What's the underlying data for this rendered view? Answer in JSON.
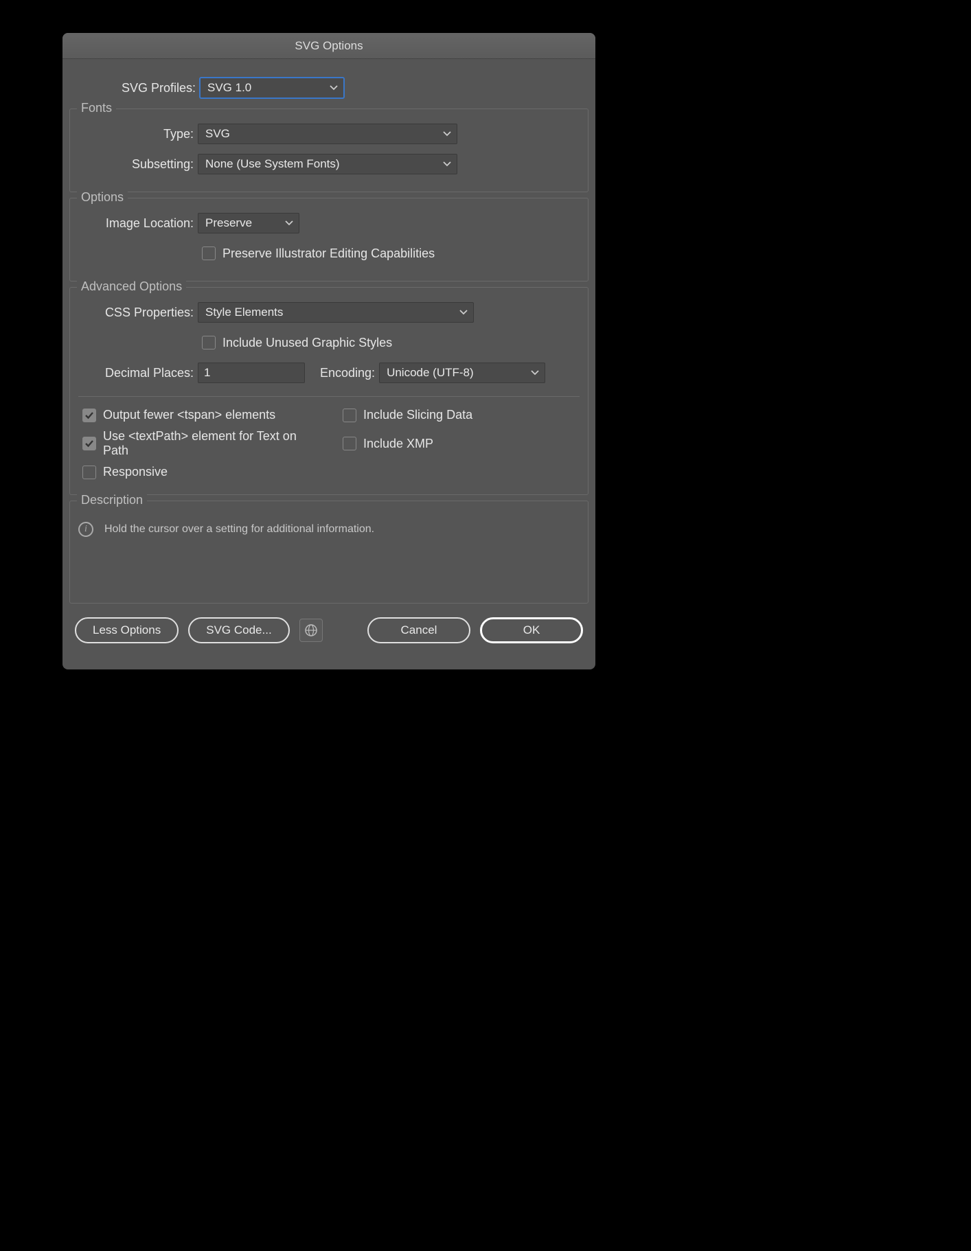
{
  "title": "SVG Options",
  "profiles": {
    "label": "SVG Profiles:",
    "value": "SVG 1.0"
  },
  "fonts": {
    "title": "Fonts",
    "type_label": "Type:",
    "type_value": "SVG",
    "subsetting_label": "Subsetting:",
    "subsetting_value": "None (Use System Fonts)"
  },
  "options": {
    "title": "Options",
    "image_location_label": "Image Location:",
    "image_location_value": "Preserve",
    "preserve_editing_label": "Preserve Illustrator Editing Capabilities",
    "preserve_editing_checked": false
  },
  "advanced": {
    "title": "Advanced Options",
    "css_label": "CSS Properties:",
    "css_value": "Style Elements",
    "include_unused_label": "Include Unused Graphic Styles",
    "include_unused_checked": false,
    "decimal_label": "Decimal Places:",
    "decimal_value": "1",
    "encoding_label": "Encoding:",
    "encoding_value": "Unicode (UTF-8)",
    "output_tspan_label": "Output fewer <tspan> elements",
    "output_tspan_checked": true,
    "textpath_label": "Use <textPath> element for Text on Path",
    "textpath_checked": true,
    "responsive_label": "Responsive",
    "responsive_checked": false,
    "slicing_label": "Include Slicing Data",
    "slicing_checked": false,
    "xmp_label": "Include XMP",
    "xmp_checked": false
  },
  "description": {
    "title": "Description",
    "text": "Hold the cursor over a setting for additional information."
  },
  "footer": {
    "less": "Less Options",
    "svg_code": "SVG Code...",
    "cancel": "Cancel",
    "ok": "OK"
  }
}
